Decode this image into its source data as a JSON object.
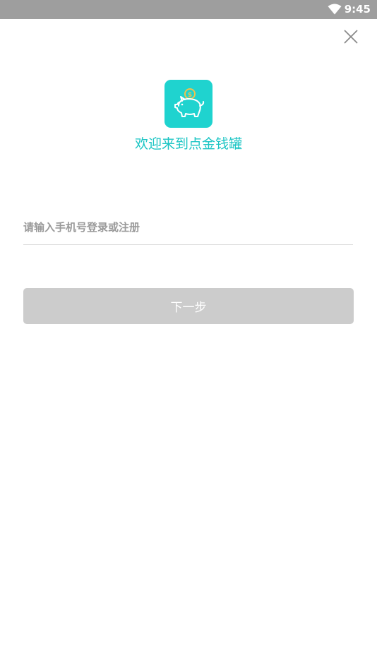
{
  "status_bar": {
    "time": "9:45",
    "wifi_icon": "wifi-icon"
  },
  "header": {
    "close_icon": "close-icon"
  },
  "logo": {
    "icon": "piggy-bank-icon",
    "coin_symbol": "$",
    "background_color": "#1fd3cf"
  },
  "welcome": {
    "title": "欢迎来到点金钱罐",
    "color": "#1cc5c4"
  },
  "login": {
    "phone_placeholder": "请输入手机号登录或注册",
    "phone_value": "",
    "next_label": "下一步",
    "next_button_color": "#cccccc"
  }
}
